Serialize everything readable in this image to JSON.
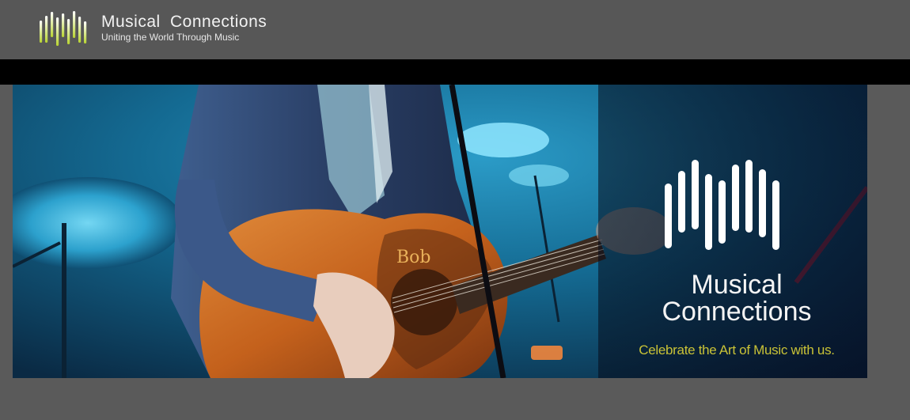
{
  "header": {
    "brand_name": "Musical  Connections",
    "tagline": "Uniting the World Through Music",
    "logo_icon": "sound-bars-icon",
    "logo_gradient": [
      "#c9e23a",
      "#ffffff"
    ]
  },
  "banner": {
    "title_line1": "Musical",
    "title_line2": "Connections",
    "tagline": "Celebrate the Art of Music with us.",
    "tagline_color": "#c9c236",
    "guitar_sticker": "Bob",
    "mark_icon": "sound-bars-icon"
  },
  "colors": {
    "page_bg": "#5a5a5a",
    "header_bg": "#575757",
    "divider_bar": "#000000",
    "stage_blue": "#1a8fb8"
  }
}
